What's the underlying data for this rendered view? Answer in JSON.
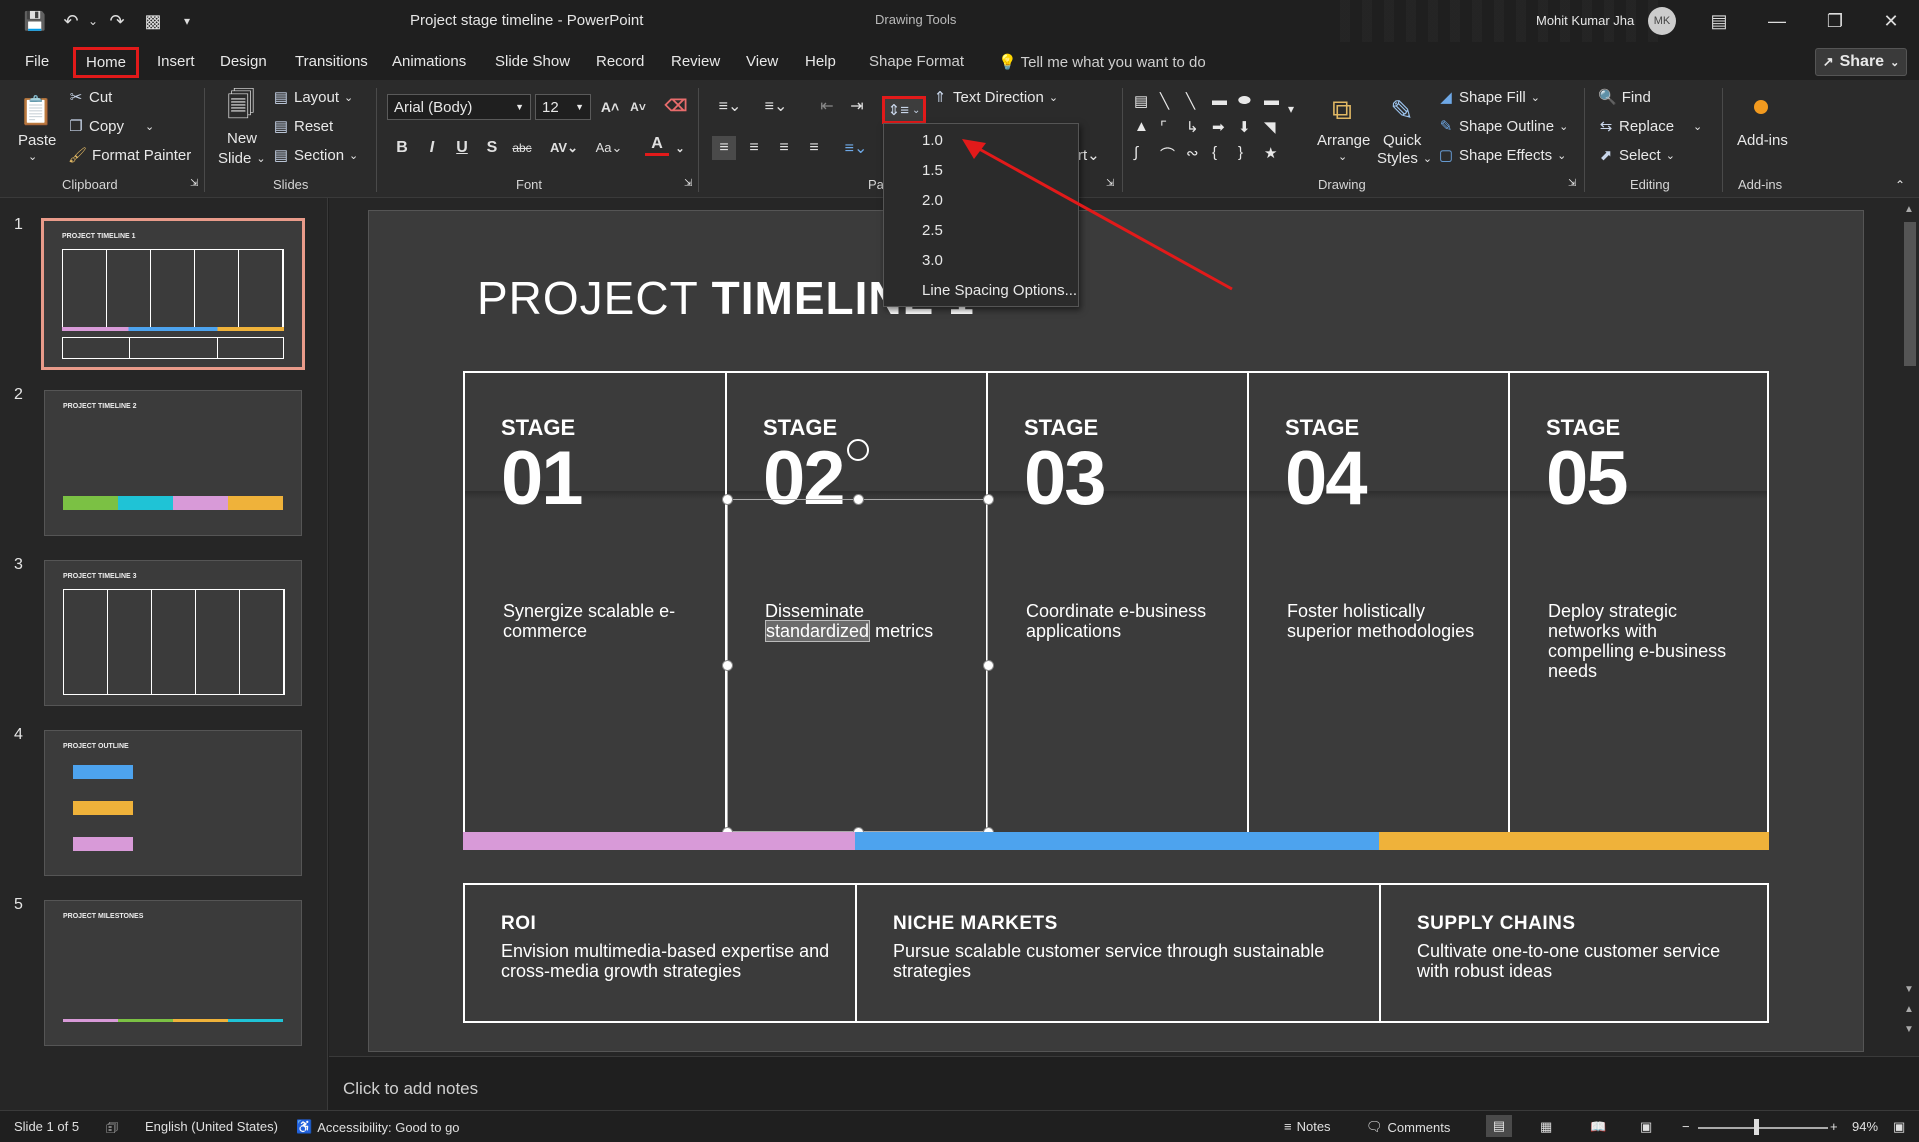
{
  "window": {
    "title": "Project stage timeline  -  PowerPoint",
    "context_tab_group": "Drawing Tools",
    "user_name": "Mohit Kumar Jha",
    "user_initials": "MK"
  },
  "menu": {
    "file": "File",
    "home": "Home",
    "insert": "Insert",
    "design": "Design",
    "transitions": "Transitions",
    "animations": "Animations",
    "slide_show": "Slide Show",
    "record": "Record",
    "review": "Review",
    "view": "View",
    "help": "Help",
    "shape_format": "Shape Format",
    "tell_me": "Tell me what you want to do",
    "share": "Share"
  },
  "ribbon": {
    "clipboard": {
      "paste": "Paste",
      "cut": "Cut",
      "copy": "Copy",
      "format_painter": "Format Painter",
      "label": "Clipboard"
    },
    "slides": {
      "new_slide_1": "New",
      "new_slide_2": "Slide",
      "layout": "Layout",
      "reset": "Reset",
      "section": "Section",
      "label": "Slides"
    },
    "font": {
      "family": "Arial (Body)",
      "size": "12",
      "label": "Font"
    },
    "paragraph": {
      "label": "Pa",
      "text_direction": "Text Direction"
    },
    "drawing": {
      "arrange": "Arrange",
      "quick_styles_1": "Quick",
      "quick_styles_2": "Styles",
      "shape_fill": "Shape Fill",
      "shape_outline": "Shape Outline",
      "shape_effects": "Shape Effects",
      "label": "Drawing"
    },
    "editing": {
      "find": "Find",
      "replace": "Replace",
      "select": "Select",
      "label": "Editing"
    },
    "addins": {
      "button": "Add-ins",
      "label": "Add-ins"
    }
  },
  "line_spacing_menu": {
    "items": [
      "1.0",
      "1.5",
      "2.0",
      "2.5",
      "3.0"
    ],
    "options": "Line Spacing Options..."
  },
  "thumbnails": [
    {
      "num": "1",
      "title": "PROJECT TIMELINE 1"
    },
    {
      "num": "2",
      "title": "PROJECT TIMELINE 2"
    },
    {
      "num": "3",
      "title": "PROJECT TIMELINE 3"
    },
    {
      "num": "4",
      "title": "PROJECT OUTLINE"
    },
    {
      "num": "5",
      "title": "PROJECT MILESTONES"
    }
  ],
  "slide": {
    "title_light": "PROJECT ",
    "title_bold": "TIMELINE 1",
    "stage_label": "STAGE",
    "stages": [
      {
        "num": "01",
        "desc": "Synergize scalable e-commerce"
      },
      {
        "num": "02",
        "desc_a": "Disseminate",
        "desc_b": "standardized",
        "desc_c": " metrics"
      },
      {
        "num": "03",
        "desc": "Coordinate e-business applications"
      },
      {
        "num": "04",
        "desc": "Foster holistically superior methodologies"
      },
      {
        "num": "05",
        "desc": "Deploy strategic networks with compelling e-business needs"
      }
    ],
    "bottom": [
      {
        "head": "ROI",
        "body": "Envision multimedia-based expertise and cross-media growth strategies"
      },
      {
        "head": "NICHE MARKETS",
        "body": "Pursue scalable customer service through sustainable strategies"
      },
      {
        "head": "SUPPLY CHAINS",
        "body": "Cultivate one-to-one customer service with robust ideas"
      }
    ],
    "colors": {
      "pink": "#d89ad8",
      "blue": "#4da3ee",
      "orange": "#efb23a"
    }
  },
  "notes": {
    "placeholder": "Click to add notes"
  },
  "status": {
    "slide_of": "Slide 1 of 5",
    "language": "English (United States)",
    "accessibility": "Accessibility: Good to go",
    "notes": "Notes",
    "comments": "Comments",
    "zoom": "94%"
  }
}
